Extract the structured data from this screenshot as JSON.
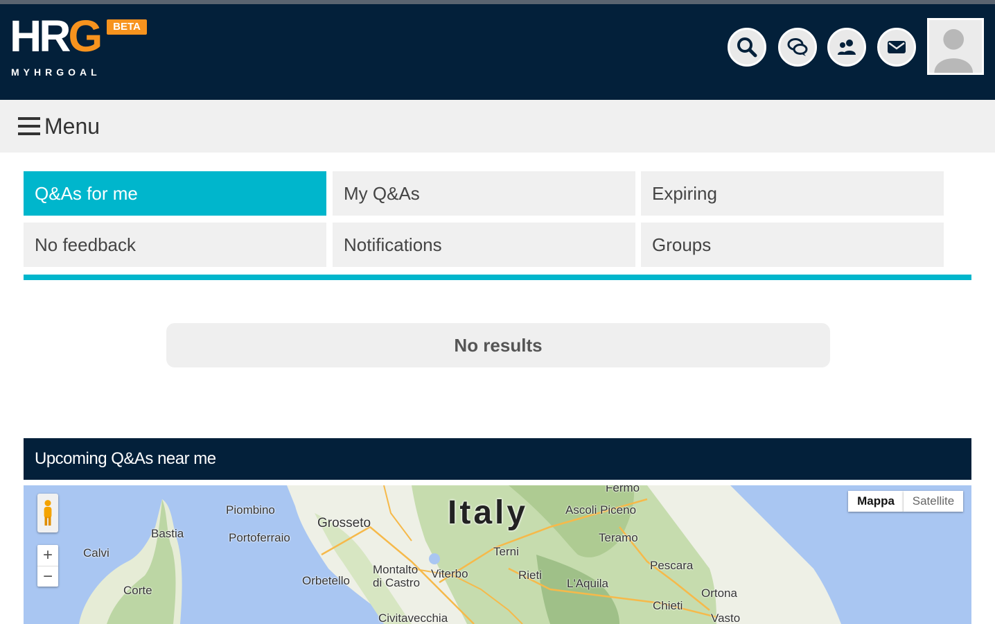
{
  "header": {
    "logo_main_a": "HR",
    "logo_main_b": "G",
    "logo_beta": "BETA",
    "logo_sub": "MYHRGOAL",
    "icons": [
      "search-icon",
      "chat-icon",
      "users-icon",
      "mail-icon"
    ],
    "avatar": "avatar-placeholder"
  },
  "menu": {
    "label": "Menu"
  },
  "tabs": [
    {
      "label": "Q&As for me",
      "active": true
    },
    {
      "label": "My Q&As",
      "active": false
    },
    {
      "label": "Expiring",
      "active": false
    },
    {
      "label": "No feedback",
      "active": false
    },
    {
      "label": "Notifications",
      "active": false
    },
    {
      "label": "Groups",
      "active": false
    }
  ],
  "results": {
    "empty_text": "No results"
  },
  "map_panel": {
    "title": "Upcoming Q&As near me",
    "map_type": {
      "map_label": "Mappa",
      "satellite_label": "Satellite"
    },
    "zoom_in": "+",
    "zoom_out": "−",
    "country": "Italy",
    "places": [
      "Fermo",
      "Piombino",
      "Grosseto",
      "Ascoli Piceno",
      "Bastia",
      "Portoferraio",
      "Teramo",
      "Calvi",
      "Terni",
      "Pescara",
      "Montalto di Castro",
      "Viterbo",
      "Rieti",
      "Orbetello",
      "L'Aquila",
      "Corte",
      "Ortona",
      "Chieti",
      "Civitavecchia",
      "Vasto"
    ]
  },
  "colors": {
    "navy": "#03203a",
    "accent": "#00b6cc",
    "orange": "#f7931e"
  }
}
